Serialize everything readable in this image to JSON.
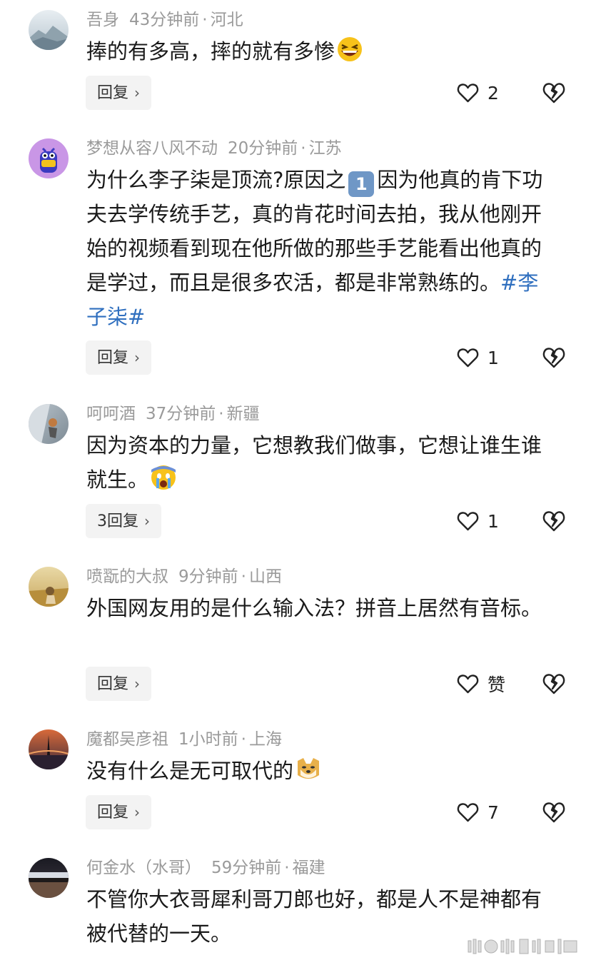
{
  "comments": [
    {
      "user": "吾身",
      "time": "43分钟前",
      "sep": "·",
      "location": "河北",
      "text": "捧的有多高，摔的就有多惨",
      "emoji": "grinning-squint-emoji",
      "reply_label": "回复",
      "likes": "2"
    },
    {
      "user": "梦想从容八风不动",
      "time": "20分钟前",
      "sep": "·",
      "location": "江苏",
      "text_line1": "为什么李子柒是顶流?原因之",
      "text_rest": "因为他真的肯下功夫去学传统手艺，真的肯花时间去拍，我从他刚开始的视频看到现在他所做的那些手艺能看出他真的是学过，而且是很多农活，都是非常熟练的。",
      "keycap": "1",
      "hashtag": "#李子柒#",
      "reply_label": "回复",
      "likes": "1"
    },
    {
      "user": "呵呵酒",
      "time": "37分钟前",
      "sep": "·",
      "location": "新疆",
      "text": "因为资本的力量，它想教我们做事，它想让谁生谁就生。",
      "emoji": "crying-face-emoji",
      "reply_label": "3回复",
      "likes": "1"
    },
    {
      "user": "喷翫的大叔",
      "time": "9分钟前",
      "sep": "·",
      "location": "山西",
      "text": "外国网友用的是什么输入法？拼音上居然有音标。",
      "reply_label": "回复",
      "likes": "赞"
    },
    {
      "user": "魔都吴彦祖",
      "time": "1小时前",
      "sep": "·",
      "location": "上海",
      "text": "没有什么是无可取代的",
      "emoji": "doge-emoji",
      "reply_label": "回复",
      "likes": "7"
    },
    {
      "user": "何金水（水哥）",
      "time": "59分钟前",
      "sep": "·",
      "location": "福建",
      "text": "不管你大衣哥犀利哥刀郎也好，都是人不是神都有被代替的一天。"
    }
  ],
  "colors": {
    "meta": "#9a9a9a",
    "text": "#1a1a1a",
    "hashtag": "#2f6fbf",
    "reply_bg": "#f3f3f3"
  }
}
